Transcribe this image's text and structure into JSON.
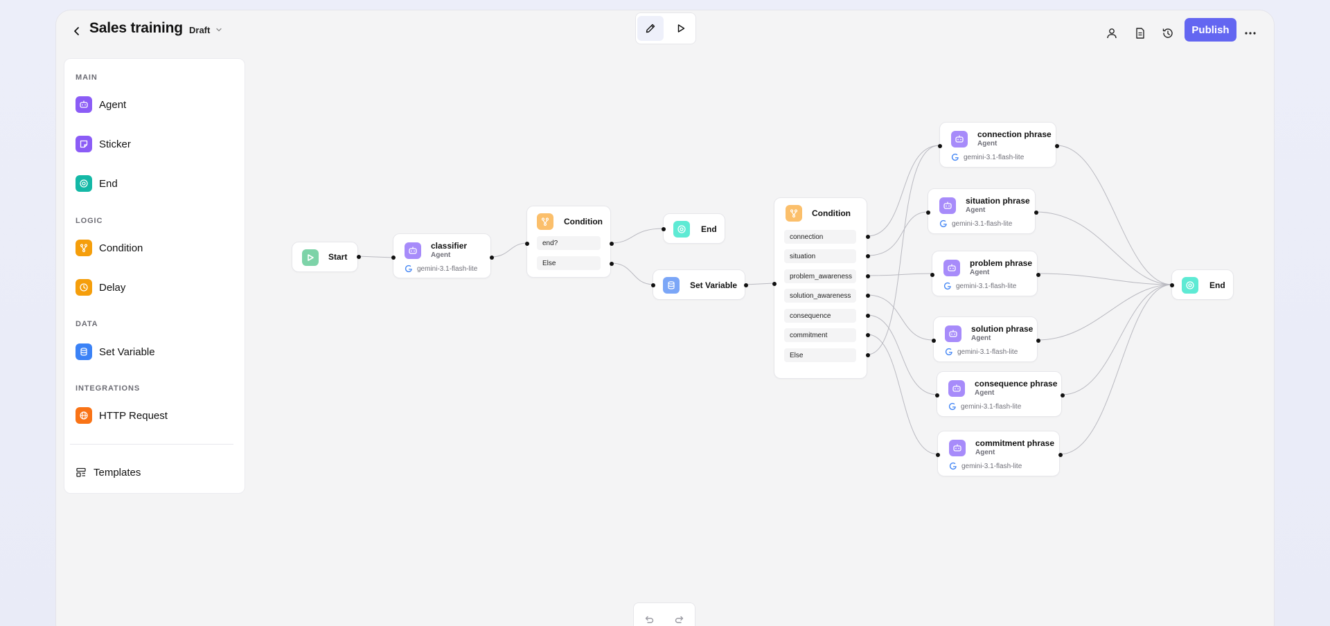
{
  "header": {
    "title": "Sales training",
    "status": "Draft",
    "publish_label": "Publish"
  },
  "sidebar": {
    "sections": {
      "main": "MAIN",
      "logic": "LOGIC",
      "data": "DATA",
      "integrations": "INTEGRATIONS"
    },
    "items": {
      "agent": "Agent",
      "sticker": "Sticker",
      "end": "End",
      "condition": "Condition",
      "delay": "Delay",
      "set_variable": "Set Variable",
      "http_request": "HTTP Request",
      "templates": "Templates"
    }
  },
  "nodes": {
    "start": "Start",
    "classifier": {
      "title": "classifier",
      "type": "Agent",
      "model": "gemini-3.1-flash-lite"
    },
    "condition1": {
      "title": "Condition",
      "branches": [
        "end?",
        "Else"
      ]
    },
    "end1": "End",
    "set_variable": "Set Variable",
    "condition2": {
      "title": "Condition",
      "branches": [
        "connection",
        "situation",
        "problem_awareness",
        "solution_awareness",
        "consequence",
        "commitment",
        "Else"
      ]
    },
    "phrases": [
      {
        "title": "connection phrase",
        "type": "Agent",
        "model": "gemini-3.1-flash-lite"
      },
      {
        "title": "situation phrase",
        "type": "Agent",
        "model": "gemini-3.1-flash-lite"
      },
      {
        "title": "problem phrase",
        "type": "Agent",
        "model": "gemini-3.1-flash-lite"
      },
      {
        "title": "solution phrase",
        "type": "Agent",
        "model": "gemini-3.1-flash-lite"
      },
      {
        "title": "consequence phrase",
        "type": "Agent",
        "model": "gemini-3.1-flash-lite"
      },
      {
        "title": "commitment phrase",
        "type": "Agent",
        "model": "gemini-3.1-flash-lite"
      }
    ],
    "end2": "End"
  },
  "colors": {
    "accent": "#6366f1",
    "agent": "#8b5cf6",
    "end": "#14b8a6",
    "condition": "#f59e0b",
    "set_variable": "#3b82f6",
    "http": "#f97316",
    "start": "#4ade80"
  }
}
